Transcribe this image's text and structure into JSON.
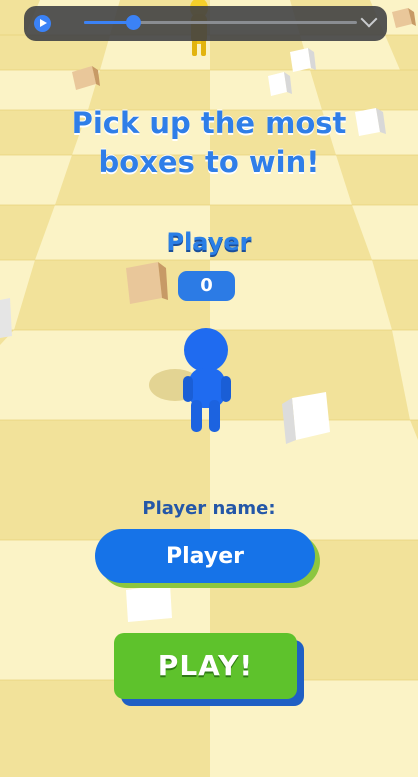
{
  "media": {
    "progress": 0.18
  },
  "game": {
    "headline_line1": "Pick up the most",
    "headline_line2": "boxes to win!",
    "player_title": "Player",
    "score": "0",
    "name_label": "Player name:",
    "name_value": "Player",
    "play_label": "PLAY!"
  },
  "colors": {
    "accent_blue": "#1673e8",
    "play_green": "#5ec22c",
    "floor_light": "#fbf3c6",
    "floor_dark": "#f2e29a"
  },
  "icons": [
    "play-icon",
    "chevron-down-icon"
  ]
}
